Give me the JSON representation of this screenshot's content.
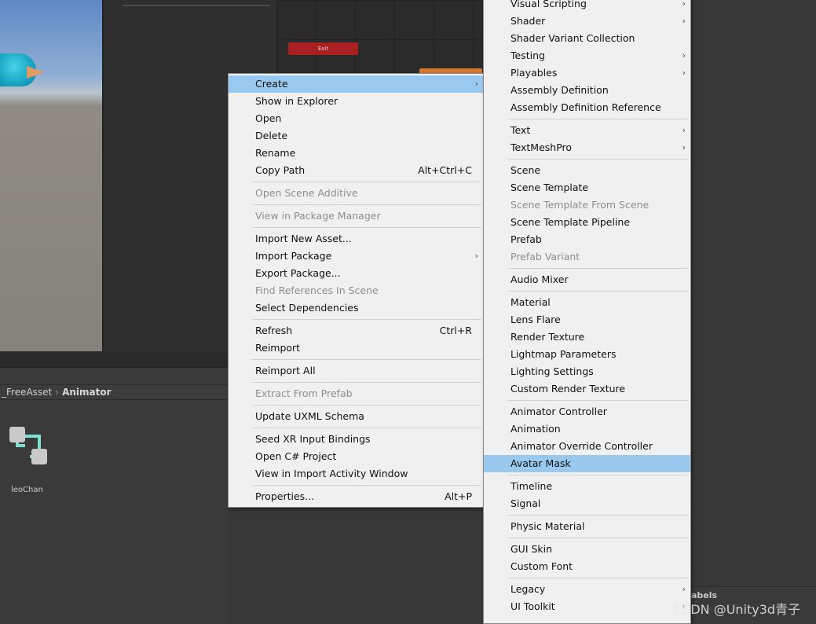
{
  "scene": {
    "exit_node_label": "Exit"
  },
  "project": {
    "breadcrumb": [
      "_FreeAsset",
      "Animator"
    ],
    "asset_label": "leoChan"
  },
  "context_menu": {
    "items": [
      {
        "label": "Create",
        "state": "highlighted",
        "submenu": true
      },
      {
        "label": "Show in Explorer"
      },
      {
        "label": "Open"
      },
      {
        "label": "Delete"
      },
      {
        "label": "Rename"
      },
      {
        "label": "Copy Path",
        "shortcut": "Alt+Ctrl+C"
      },
      {
        "separator": true
      },
      {
        "label": "Open Scene Additive",
        "state": "disabled"
      },
      {
        "separator": true
      },
      {
        "label": "View in Package Manager",
        "state": "disabled"
      },
      {
        "separator": true
      },
      {
        "label": "Import New Asset..."
      },
      {
        "label": "Import Package",
        "submenu": true
      },
      {
        "label": "Export Package..."
      },
      {
        "label": "Find References In Scene",
        "state": "disabled"
      },
      {
        "label": "Select Dependencies"
      },
      {
        "separator": true
      },
      {
        "label": "Refresh",
        "shortcut": "Ctrl+R"
      },
      {
        "label": "Reimport"
      },
      {
        "separator": true
      },
      {
        "label": "Reimport All"
      },
      {
        "separator": true
      },
      {
        "label": "Extract From Prefab",
        "state": "disabled"
      },
      {
        "separator": true
      },
      {
        "label": "Update UXML Schema"
      },
      {
        "separator": true
      },
      {
        "label": "Seed XR Input Bindings"
      },
      {
        "label": "Open C# Project"
      },
      {
        "label": "View in Import Activity Window"
      },
      {
        "separator": true
      },
      {
        "label": "Properties...",
        "shortcut": "Alt+P"
      }
    ]
  },
  "create_submenu": {
    "items": [
      {
        "label": "Visual Scripting",
        "submenu": true
      },
      {
        "label": "Shader",
        "submenu": true
      },
      {
        "label": "Shader Variant Collection"
      },
      {
        "label": "Testing",
        "submenu": true
      },
      {
        "label": "Playables",
        "submenu": true
      },
      {
        "label": "Assembly Definition"
      },
      {
        "label": "Assembly Definition Reference"
      },
      {
        "separator": true
      },
      {
        "label": "Text",
        "submenu": true
      },
      {
        "label": "TextMeshPro",
        "submenu": true
      },
      {
        "separator": true
      },
      {
        "label": "Scene"
      },
      {
        "label": "Scene Template"
      },
      {
        "label": "Scene Template From Scene",
        "state": "disabled"
      },
      {
        "label": "Scene Template Pipeline"
      },
      {
        "label": "Prefab"
      },
      {
        "label": "Prefab Variant",
        "state": "disabled"
      },
      {
        "separator": true
      },
      {
        "label": "Audio Mixer"
      },
      {
        "separator": true
      },
      {
        "label": "Material"
      },
      {
        "label": "Lens Flare"
      },
      {
        "label": "Render Texture"
      },
      {
        "label": "Lightmap Parameters"
      },
      {
        "label": "Lighting Settings"
      },
      {
        "label": "Custom Render Texture"
      },
      {
        "separator": true
      },
      {
        "label": "Animator Controller"
      },
      {
        "label": "Animation"
      },
      {
        "label": "Animator Override Controller"
      },
      {
        "label": "Avatar Mask",
        "state": "highlighted"
      },
      {
        "separator": true
      },
      {
        "label": "Timeline"
      },
      {
        "label": "Signal"
      },
      {
        "separator": true
      },
      {
        "label": "Physic Material"
      },
      {
        "separator": true
      },
      {
        "label": "GUI Skin"
      },
      {
        "label": "Custom Font"
      },
      {
        "separator": true
      },
      {
        "label": "Legacy",
        "submenu": true
      },
      {
        "label": "UI Toolkit",
        "submenu": true
      }
    ]
  },
  "right_panel": {
    "labels_text": "abels"
  },
  "watermark": "CSDN @Unity3d青子",
  "colors": {
    "menu_bg": "#f0f0f0",
    "highlight": "#99c9ef",
    "disabled_text": "#8e8e8e",
    "editor_bg": "#383838",
    "exit_node": "#a82020",
    "asset_icon": "#7de0d0"
  }
}
